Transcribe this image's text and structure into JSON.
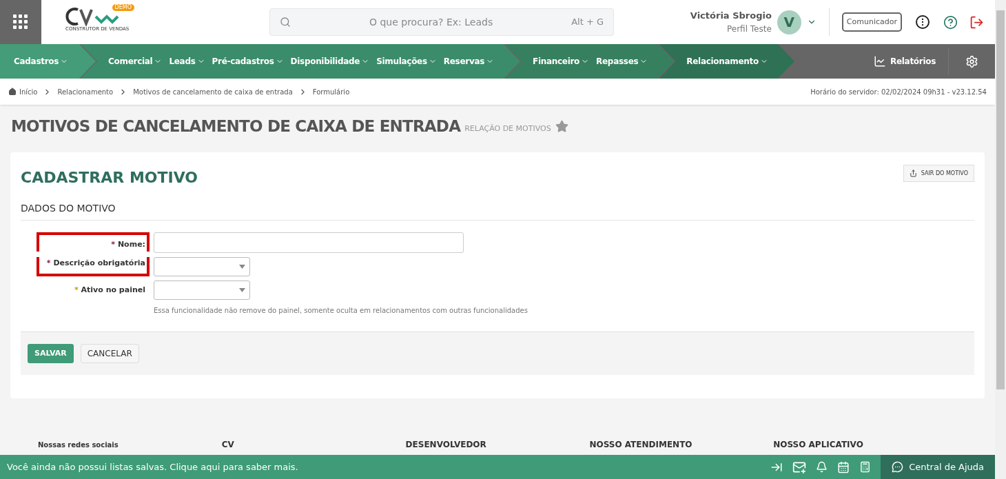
{
  "header": {
    "search": {
      "placeholder": "O que procura? Ex: Leads",
      "shortcut": "Alt + G"
    },
    "logo": {
      "badge": "DEMO",
      "tagline": "CONSTRUTOR DE VENDAS"
    },
    "user": {
      "name": "Victória Sbrogio",
      "profile": "Perfil Teste",
      "initial": "V"
    },
    "communicator": "Comunicador"
  },
  "nav": {
    "groups": [
      {
        "items": [
          "Cadastros"
        ]
      },
      {
        "items": [
          "Comercial",
          "Leads",
          "Pré-cadastros",
          "Disponibilidade",
          "Simulações",
          "Reservas"
        ]
      },
      {
        "items": [
          "Financeiro",
          "Repasses"
        ]
      },
      {
        "items": [
          "Relacionamento"
        ]
      }
    ],
    "reports": "Relatórios"
  },
  "breadcrumb": {
    "items": [
      "Início",
      "Relacionamento",
      "Motivos de cancelamento de caixa de entrada",
      "Formulário"
    ],
    "server_time": "Horário do servidor: 02/02/2024 09h31 - v23.12.54"
  },
  "page": {
    "title": "MOTIVOS DE CANCELAMENTO DE CAIXA DE ENTRADA",
    "subtitle": "RELAÇÃO DE MOTIVOS",
    "favorite": false
  },
  "form": {
    "title": "CADASTRAR MOTIVO",
    "exit_button": "SAIR DO MOTIVO",
    "section": "DADOS DO MOTIVO",
    "fields": [
      {
        "kind": "text",
        "required_mark": "*",
        "label": "Nome:",
        "highlighted": true
      },
      {
        "kind": "select",
        "required_mark": "*",
        "label": "Descrição obrigatória",
        "highlighted": true
      },
      {
        "kind": "select",
        "required_mark": "*",
        "label": "Ativo no painel",
        "highlighted": false,
        "help": "Essa funcionalidade não remove do painel, somente oculta em relacionamentos com outras funcionalidades"
      }
    ],
    "buttons": [
      {
        "kind": "primary",
        "label": "SALVAR"
      },
      {
        "kind": "secondary",
        "label": "CANCELAR"
      }
    ]
  },
  "footer": {
    "columns": [
      "Nossas redes sociais",
      "CV",
      "DESENVOLVEDOR",
      "NOSSO ATENDIMENTO",
      "NOSSO APLICATIVO"
    ]
  },
  "status_bar": {
    "message": "Você ainda não possui listas salvas. Clique aqui para saber mais.",
    "help": "Central de Ajuda"
  }
}
